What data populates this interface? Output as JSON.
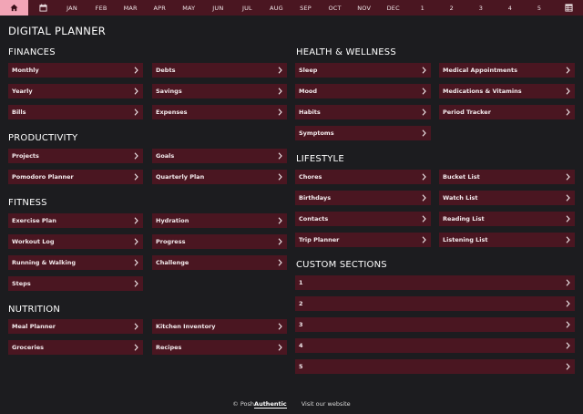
{
  "nav": {
    "home_icon": "home-icon",
    "calendar_icon": "calendar-icon",
    "months": [
      "JAN",
      "FEB",
      "MAR",
      "APR",
      "MAY",
      "JUN",
      "JUL",
      "AUG",
      "SEP",
      "OCT",
      "NOV",
      "DEC"
    ],
    "numbers": [
      "1",
      "2",
      "3",
      "4",
      "5"
    ],
    "grid_icon": "grid-table-icon"
  },
  "page_title": "DIGITAL PLANNER",
  "sections": {
    "finances": {
      "title": "FINANCES",
      "items": [
        "Monthly",
        "Yearly",
        "Bills",
        "Debts",
        "Savings",
        "Expenses"
      ]
    },
    "productivity": {
      "title": "PRODUCTIVITY",
      "items": [
        "Projects",
        "Pomodoro Planner",
        "Goals",
        "Quarterly Plan"
      ]
    },
    "fitness": {
      "title": "FITNESS",
      "items": [
        "Exercise Plan",
        "Workout Log",
        "Running & Walking",
        "Steps",
        "Hydration",
        "Progress",
        "Challenge"
      ]
    },
    "nutrition": {
      "title": "NUTRITION",
      "items": [
        "Meal Planner",
        "Groceries",
        "Kitchen Inventory",
        "Recipes"
      ]
    },
    "health": {
      "title": "HEALTH & WELLNESS",
      "items": [
        "Sleep",
        "Mood",
        "Habits",
        "Symptoms",
        "Medical Appointments",
        "Medications & Vitamins",
        "Period Tracker"
      ]
    },
    "lifestyle": {
      "title": "LIFESTYLE",
      "items": [
        "Chores",
        "Birthdays",
        "Contacts",
        "Trip Planner",
        "Bucket List",
        "Watch List",
        "Reading List",
        "Listening List"
      ]
    },
    "custom": {
      "title": "CUSTOM SECTIONS",
      "items": [
        "1",
        "2",
        "3",
        "4",
        "5"
      ]
    }
  },
  "footer": {
    "copyright": "© Posh",
    "brand": "Authentic",
    "link": "Visit our website"
  },
  "colors": {
    "background": "#1c1c1f",
    "button": "#4a1621",
    "accent": "#f2a5b6"
  }
}
